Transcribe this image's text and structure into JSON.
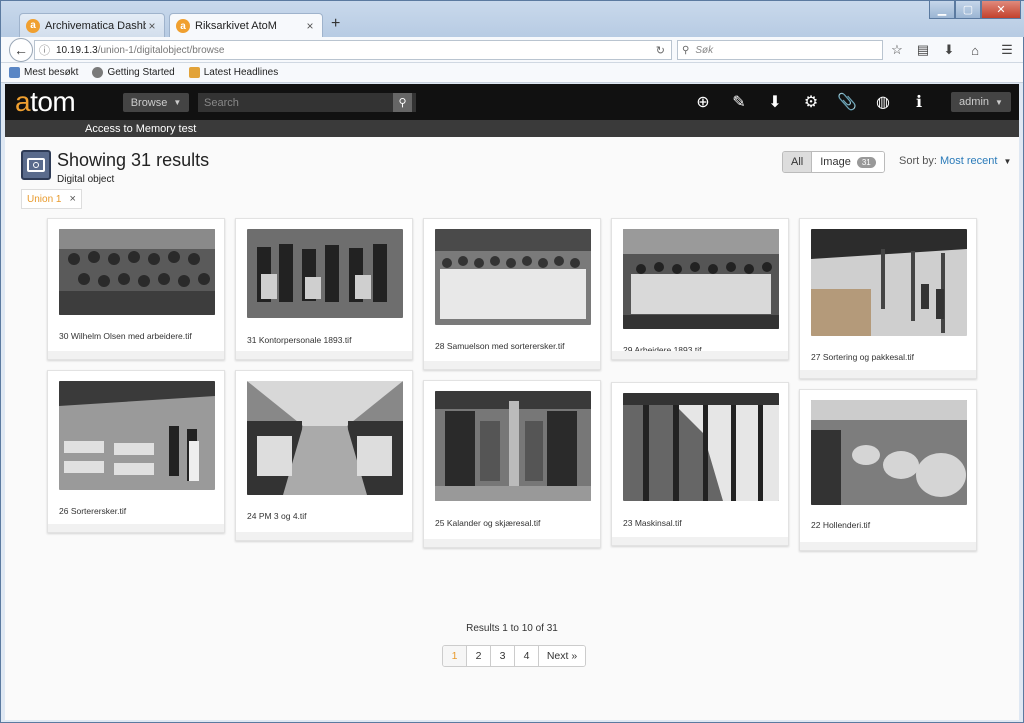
{
  "browser": {
    "tabs": [
      {
        "label": "Archivematica Dashboard ...",
        "active": false
      },
      {
        "label": "Riksarkivet AtoM",
        "active": true
      }
    ],
    "url_host": "10.19.1.3",
    "url_path": "/union-1/digitalobject/browse",
    "search_placeholder": "Søk",
    "bookmarks": [
      "Mest besøkt",
      "Getting Started",
      "Latest Headlines"
    ]
  },
  "atom": {
    "logo_a": "a",
    "logo_rest": "tom",
    "browse_label": "Browse",
    "search_placeholder": "Search",
    "admin_label": "admin",
    "site_subtitle": "Access to Memory test"
  },
  "results": {
    "title": "Showing 31 results",
    "subtitle": "Digital object",
    "filter_tag": "Union 1",
    "toggle_all": "All",
    "toggle_image": "Image",
    "image_count": "31",
    "sort_label": "Sort by:",
    "sort_value": "Most recent",
    "summary": "Results 1 to 10 of 31"
  },
  "items": [
    {
      "caption": "30 Wilhelm Olsen med arbeidere.tif"
    },
    {
      "caption": "31 Kontorpersonale 1893.tif"
    },
    {
      "caption": "28 Samuelson med sorterersker.tif"
    },
    {
      "caption": "29 Arbeidere 1893.tif"
    },
    {
      "caption": "27 Sortering og pakkesal.tif"
    },
    {
      "caption": "26 Sorterersker.tif"
    },
    {
      "caption": "24 PM 3 og 4.tif"
    },
    {
      "caption": "25 Kalander og skjæresal.tif"
    },
    {
      "caption": "23 Maskinsal.tif"
    },
    {
      "caption": "22 Hollenderi.tif"
    }
  ],
  "pagination": {
    "pages": [
      "1",
      "2",
      "3",
      "4"
    ],
    "current": "1",
    "next_label": "Next »"
  },
  "colors": {
    "accent": "#e89a2c",
    "link": "#2b7bb9",
    "header_bg": "#111111"
  }
}
